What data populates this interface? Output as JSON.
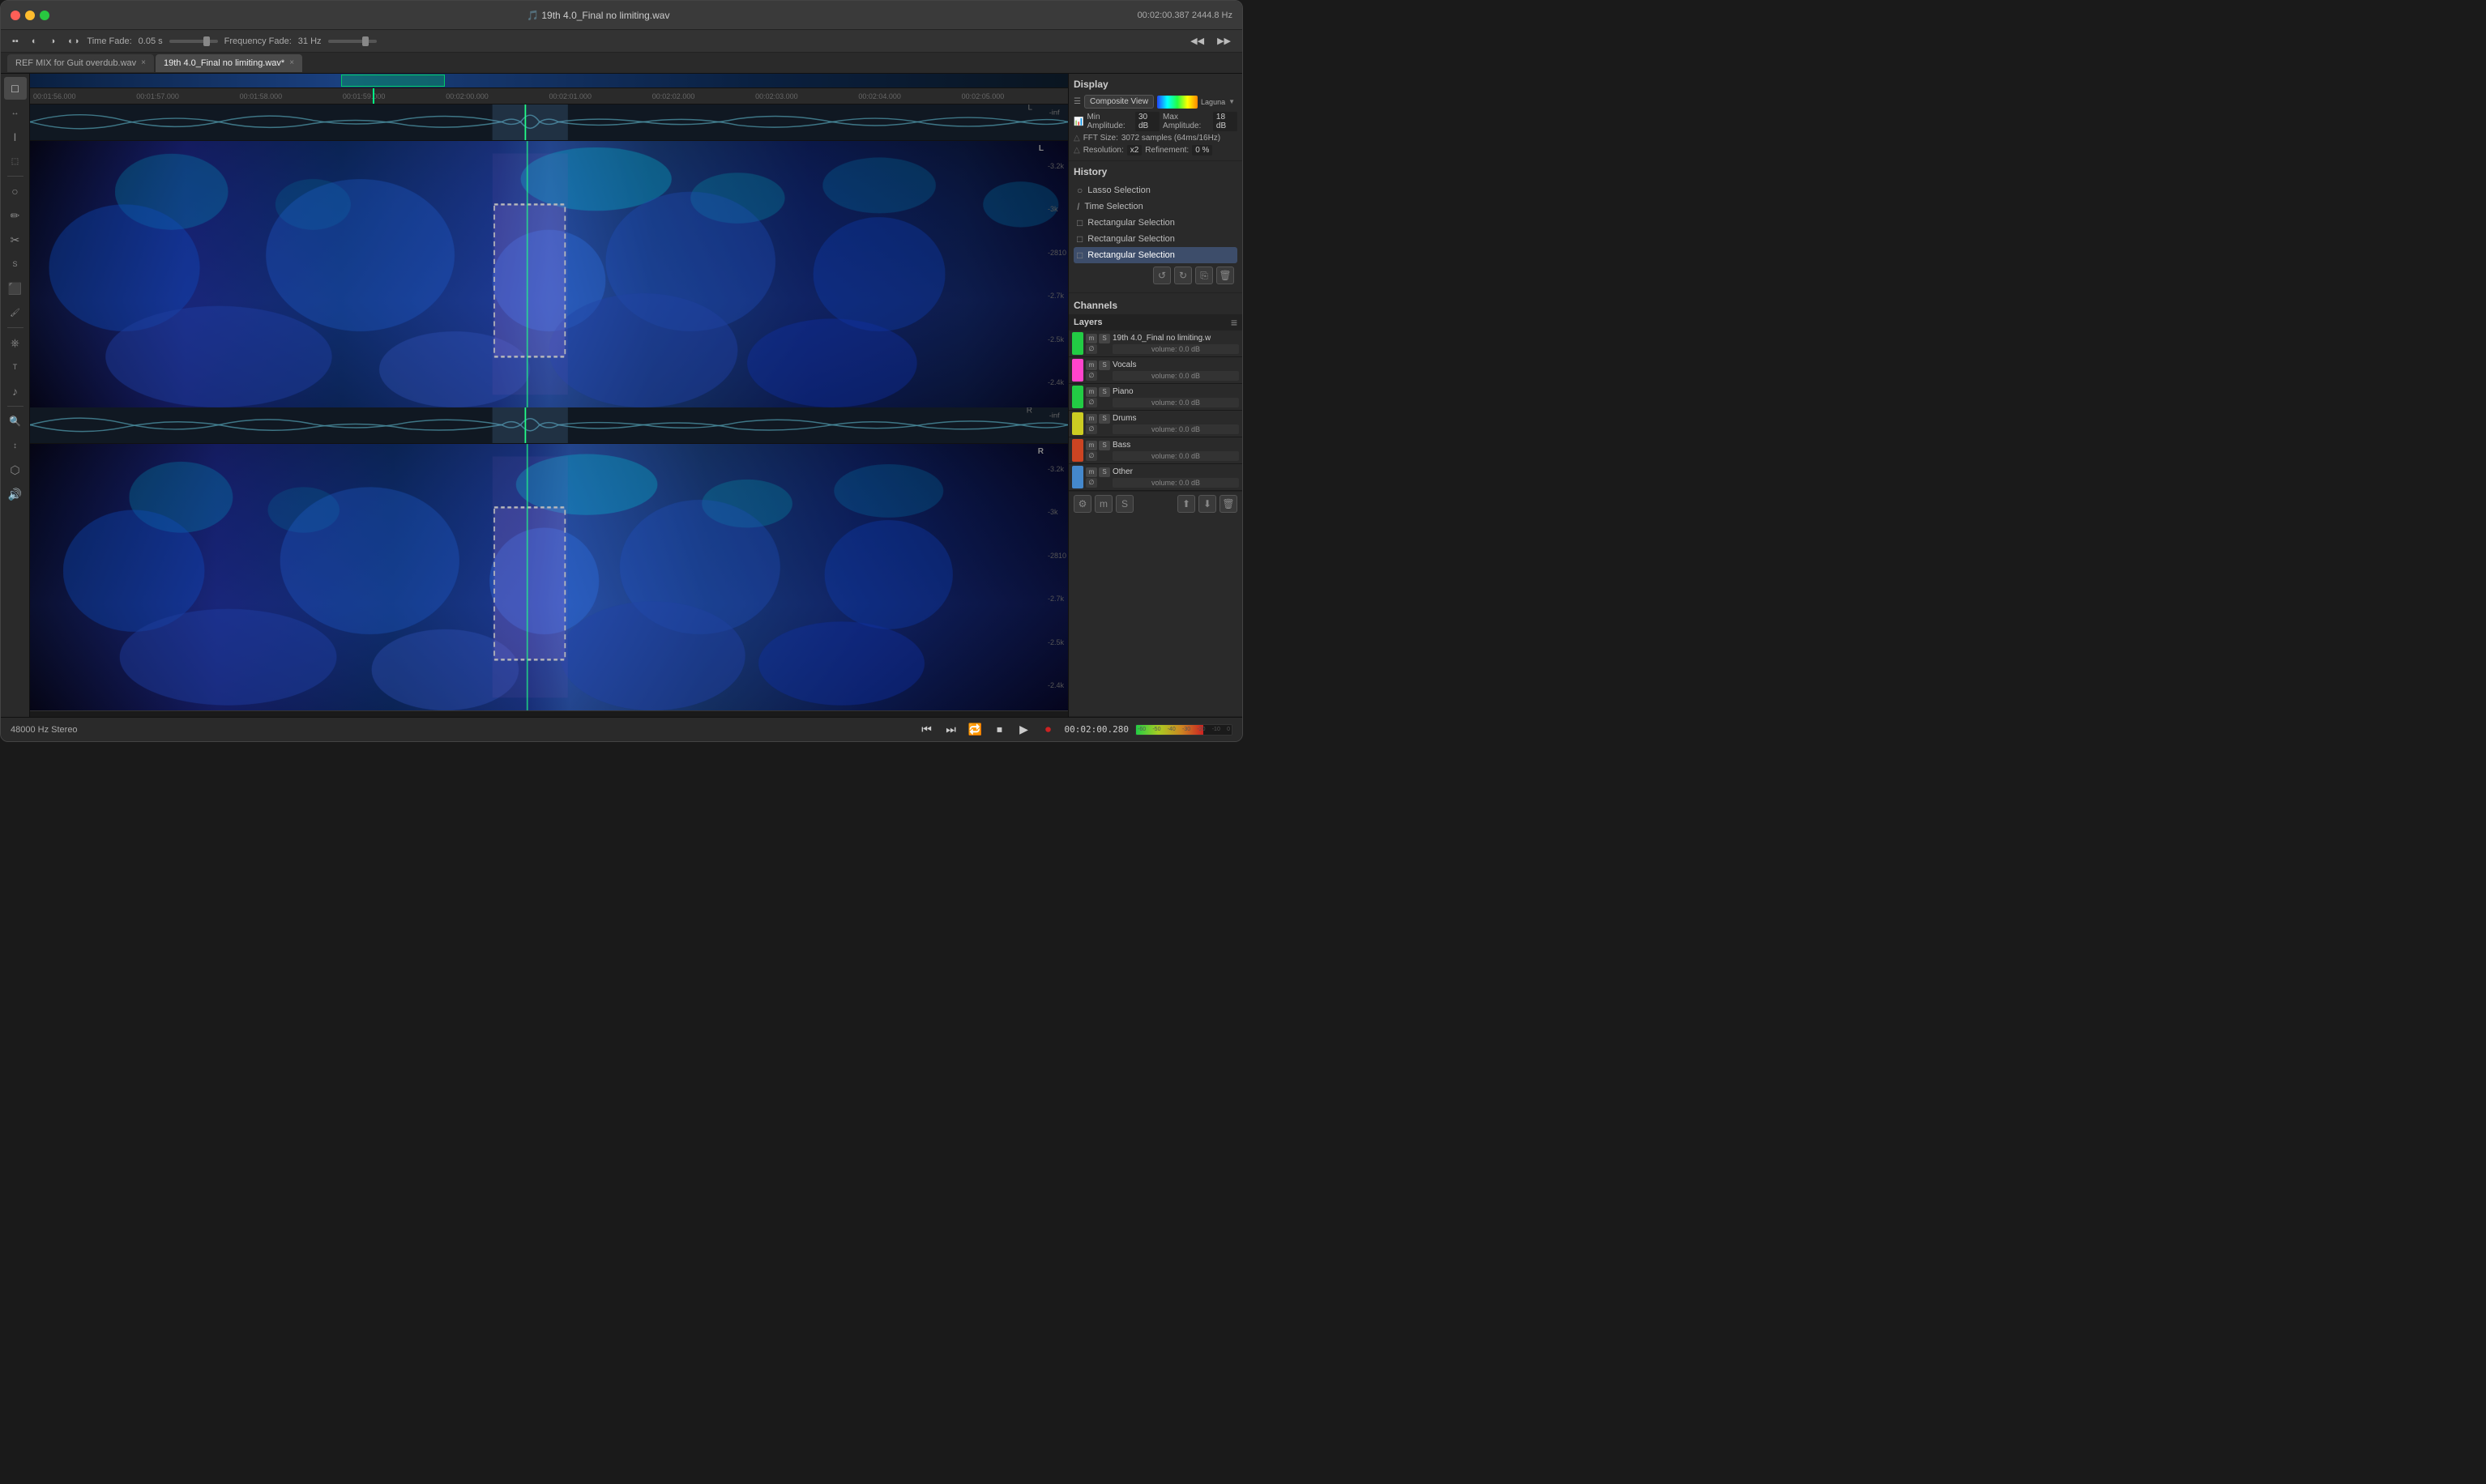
{
  "window": {
    "title": "19th 4.0_Final no limiting.wav",
    "time_display": "00:02:00.387",
    "sample_rate_display": "2444.8 Hz"
  },
  "titlebar": {
    "title": "🎵 19th 4.0_Final no limiting.wav",
    "time": "00:02:00.387  2444.8 Hz",
    "close_btn": "×",
    "min_btn": "−",
    "max_btn": "+"
  },
  "toolbar": {
    "time_fade_label": "Time Fade:",
    "time_fade_value": "0.05 s",
    "freq_fade_label": "Frequency Fade:",
    "freq_fade_value": "31  Hz"
  },
  "tabs": [
    {
      "label": "REF MIX for Guit overdub.wav",
      "active": false
    },
    {
      "label": "19th 4.0_Final no limiting.wav*",
      "active": true
    }
  ],
  "timeline": {
    "labels": [
      "00:01:56.000",
      "00:01:57.000",
      "00:01:58.000",
      "00:01:59.000",
      "00:02:00.000",
      "00:02:01.000",
      "00:02:02.000",
      "00:02:03.000",
      "00:02:04.000",
      "00:02:05.000"
    ]
  },
  "display_panel": {
    "title": "Display",
    "composite_view_label": "Composite View",
    "color_scheme": "Laguna",
    "min_amplitude_label": "Min Amplitude:",
    "min_amplitude_value": "30",
    "min_amplitude_unit": "dB",
    "max_amplitude_label": "Max Amplitude:",
    "max_amplitude_value": "18",
    "max_amplitude_unit": "dB",
    "fft_size_label": "FFT Size:",
    "fft_size_value": "3072 samples (64ms/16Hz)",
    "resolution_label": "Resolution:",
    "resolution_value": "x2",
    "refinement_label": "Refinement:",
    "refinement_value": "0 %"
  },
  "history_panel": {
    "title": "History",
    "items": [
      {
        "icon": "○",
        "label": "Lasso Selection"
      },
      {
        "icon": "I",
        "label": "Time Selection"
      },
      {
        "icon": "□",
        "label": "Rectangular Selection"
      },
      {
        "icon": "□",
        "label": "Rectangular Selection"
      },
      {
        "icon": "□",
        "label": "Rectangular Selection",
        "selected": true
      }
    ]
  },
  "channels_panel": {
    "title": "Channels"
  },
  "layers_panel": {
    "title": "Layers",
    "layers": [
      {
        "name": "19th 4.0_Final no limiting.w",
        "color": "#22cc44",
        "volume": "volume: 0.0 dB",
        "has_phase": true
      },
      {
        "name": "Vocals",
        "color": "#ff44cc",
        "volume": "volume: 0.0 dB",
        "has_phase": true
      },
      {
        "name": "Piano",
        "color": "#22cc44",
        "volume": "volume: 0.0 dB",
        "has_phase": true
      },
      {
        "name": "Drums",
        "color": "#cccc22",
        "volume": "volume: 0.0 dB",
        "has_phase": true
      },
      {
        "name": "Bass",
        "color": "#cc4422",
        "volume": "volume: 0.0 dB",
        "has_phase": true
      },
      {
        "name": "Other",
        "color": "#4488cc",
        "volume": "volume: 0.0 dB",
        "has_phase": true
      }
    ]
  },
  "bottom_bar": {
    "status": "48000 Hz Stereo",
    "time": "00:02:00.280",
    "transport_buttons": [
      "⏮",
      "⏭",
      "🔁",
      "⏹",
      "▶",
      "⏺"
    ]
  },
  "left_tools": [
    "□",
    "↔",
    "I",
    "⬚",
    "○",
    "✏",
    "✂",
    "S",
    "⬛",
    "🖌",
    "⎈",
    "T",
    "♪",
    "🔍",
    "↕",
    "⬡",
    "🔊"
  ]
}
